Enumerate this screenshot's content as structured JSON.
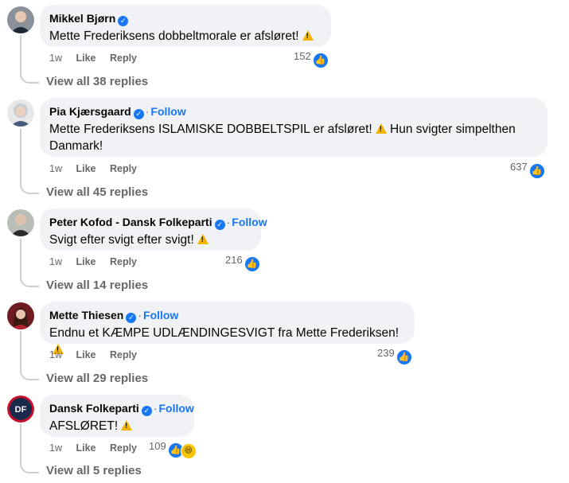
{
  "comments": [
    {
      "name": "Mikkel Bjørn",
      "show_follow": false,
      "text": "Mette Frederiksens dobbeltmorale er afsløret!",
      "time": "1w",
      "like": "Like",
      "reply": "Reply",
      "reaction_count": "152",
      "view_replies": "View all 38 replies"
    },
    {
      "name": "Pia Kjærsgaard",
      "show_follow": true,
      "text": "Mette Frederiksens ISLAMISKE DOBBELTSPIL er afsløret!",
      "text2": "Hun svigter simpelthen",
      "text3": "Danmark!",
      "time": "1w",
      "like": "Like",
      "reply": "Reply",
      "reaction_count": "637",
      "view_replies": "View all 45 replies"
    },
    {
      "name": "Peter Kofod - Dansk Folkeparti",
      "show_follow": true,
      "text": "Svigt efter svigt efter svigt!",
      "time": "1w",
      "like": "Like",
      "reply": "Reply",
      "reaction_count": "216",
      "view_replies": "View all 14 replies"
    },
    {
      "name": "Mette Thiesen",
      "show_follow": true,
      "text": "Endnu et KÆMPE UDLÆNDINGESVIGT fra Mette Frederiksen!",
      "time": "1w",
      "like": "Like",
      "reply": "Reply",
      "reaction_count": "239",
      "view_replies": "View all 29 replies"
    },
    {
      "name": "Dansk Folkeparti",
      "show_follow": true,
      "text": "AFSLØRET!",
      "time": "1w",
      "like": "Like",
      "reply": "Reply",
      "reaction_count": "109",
      "view_replies": "View all 5 replies",
      "avatar_text": "DF"
    }
  ],
  "ui": {
    "follow": "Follow",
    "dot": "·",
    "verified_glyph": "✓",
    "like_glyph": "👍",
    "haha_glyph": "😆"
  },
  "colors": {
    "accent": "#1877f2",
    "bubble": "#f0f2f5",
    "muted": "#65676b",
    "thread": "#ccd0d5",
    "warning": "#f5b400"
  }
}
